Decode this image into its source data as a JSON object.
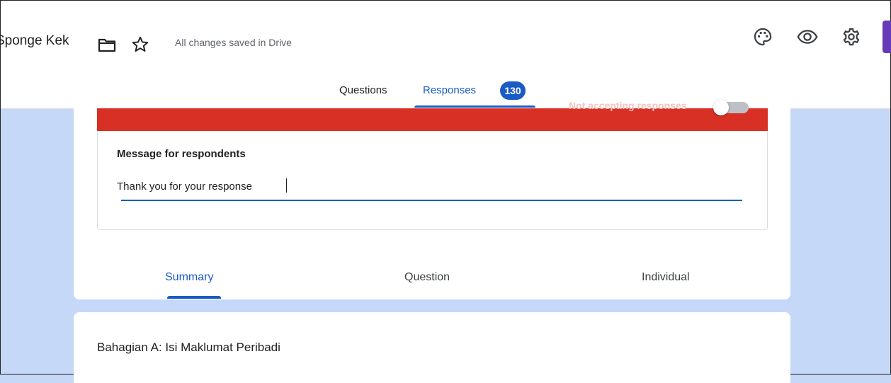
{
  "header": {
    "form_title": "Sponge Kek",
    "saved_status": "All changes saved in Drive",
    "icons": [
      "folder-icon",
      "star-icon",
      "palette-icon",
      "eye-icon",
      "gear-icon"
    ]
  },
  "tabs": {
    "questions": "Questions",
    "responses": "Responses",
    "responses_count": "130"
  },
  "responses_panel": {
    "accepting_label": "Not accepting responses",
    "accepting": false,
    "message_label": "Message for respondents",
    "message_value": "Thank you for your response",
    "subtabs": [
      "Summary",
      "Question",
      "Individual"
    ],
    "active_subtab": "Summary"
  },
  "section": {
    "title": "Bahagian A: Isi Maklumat Peribadi"
  },
  "colors": {
    "accent": "#1a5bc4",
    "banner": "#d93025",
    "background": "#c6d8f7",
    "brand": "#673ab7"
  }
}
